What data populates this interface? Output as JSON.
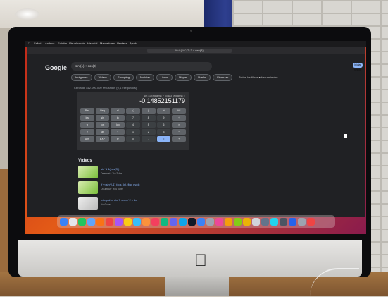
{
  "room": {},
  "menubar": {
    "items": [
      "Safari",
      "Archivo",
      "Edición",
      "Visualización",
      "Historial",
      "Marcadores",
      "Ventana",
      "Ayuda"
    ]
  },
  "browser": {
    "url": "10 ^ (1/√ (7) 3 + sen(3))"
  },
  "google": {
    "logo": "Google",
    "query": "sin (1) + cos(3)",
    "chips": [
      "Imágenes",
      "Vídeos",
      "Shopping",
      "Noticias",
      "Libros",
      "Mapas",
      "Vuelos",
      "Finanzas"
    ],
    "right_links": "Todos los filtros ▾   Herramientas",
    "signin": "Iniciar sesión",
    "result_count": "Cerca de 812.000.000 resultados (0,47 segundos)"
  },
  "calculator": {
    "expression": "sin (1 radians) + cos(3 radians) =",
    "result": "-0.14852151179",
    "keys": [
      "Rad",
      "Deg",
      "x!",
      "(",
      ")",
      "%",
      "AC",
      "Inv",
      "sin",
      "ln",
      "7",
      "8",
      "9",
      "÷",
      "π",
      "cos",
      "log",
      "4",
      "5",
      "6",
      "×",
      "e",
      "tan",
      "√",
      "1",
      "2",
      "3",
      "−",
      "Ans",
      "EXP",
      "xʸ",
      "0",
      ".",
      "=",
      "+"
    ]
  },
  "videos": {
    "heading": "Vídeos",
    "items": [
      {
        "title": "sin^1 1(cos(3))",
        "sub": "Dearmat · YouTube"
      },
      {
        "title": "If y=sin^(-1) (cos 3x), find dy/dx",
        "sub": "Doubtnut · YouTube"
      },
      {
        "title": "Integral of sin^3 x cos^2 x dx",
        "sub": "YouTube"
      }
    ]
  },
  "colors": {
    "wallpaper_start": "#c0281a",
    "wallpaper_end": "#8a1b4d",
    "accent": "#8ab4f8"
  }
}
